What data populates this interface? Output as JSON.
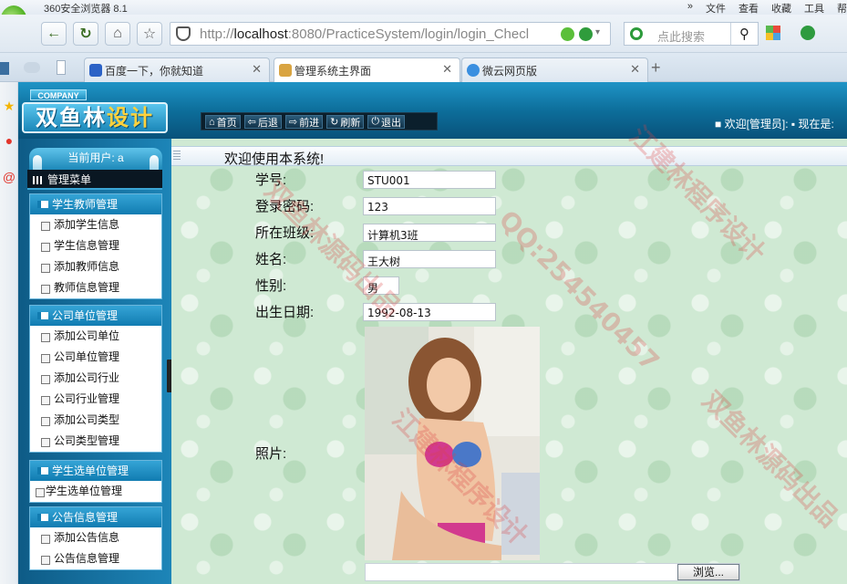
{
  "browser": {
    "title": "360安全浏览器 8.1",
    "menus": [
      "»",
      "文件",
      "查看",
      "收藏",
      "工具",
      "帮"
    ],
    "url_prefix": "http://",
    "url_host": "localhost",
    "url_rest": ":8080/PracticeSystem/login/login_Checl",
    "search_placeholder": "点此搜索",
    "tabs": [
      {
        "label": "百度一下，你就知道",
        "active": false
      },
      {
        "label": "管理系统主界面",
        "active": true
      },
      {
        "label": "微云网页版",
        "active": false
      }
    ],
    "close_glyph": "✕",
    "new_tab_glyph": "+"
  },
  "header": {
    "company": "COMPANY",
    "logo_text_a": "双鱼林",
    "logo_text_b": "设计",
    "toolbar": [
      {
        "icon": "home-icon",
        "glyph": "⌂",
        "label": "首页"
      },
      {
        "icon": "back-icon",
        "glyph": "⇦",
        "label": "后退"
      },
      {
        "icon": "forward-icon",
        "glyph": "⇨",
        "label": "前进"
      },
      {
        "icon": "refresh-icon",
        "glyph": "↻",
        "label": "刷新"
      },
      {
        "icon": "power-icon",
        "glyph": "⏻",
        "label": "退出"
      }
    ],
    "welcome": "■ 欢迎[管理员]: ▪ 现在是:"
  },
  "sidebar": {
    "current_user": "当前用户: a",
    "menu_title": "管理菜单",
    "groups": [
      {
        "title": "学生教师管理",
        "items": [
          "添加学生信息",
          "学生信息管理",
          "添加教师信息",
          "教师信息管理"
        ]
      },
      {
        "title": "公司单位管理",
        "items": [
          "添加公司单位",
          "公司单位管理",
          "添加公司行业",
          "公司行业管理",
          "添加公司类型",
          "公司类型管理"
        ]
      },
      {
        "title": "学生选单位管理",
        "items": [
          "学生选单位管理"
        ]
      },
      {
        "title": "公告信息管理",
        "items": [
          "添加公告信息",
          "公告信息管理"
        ]
      }
    ]
  },
  "main": {
    "welcome": "欢迎使用本系统!",
    "fields": [
      {
        "label": "学号:",
        "value": "STU001"
      },
      {
        "label": "登录密码:",
        "value": "123"
      },
      {
        "label": "所在班级:",
        "value": "计算机3班"
      },
      {
        "label": "姓名:",
        "value": "王大树"
      },
      {
        "label": "性别:",
        "value": "男"
      },
      {
        "label": "出生日期:",
        "value": "1992-08-13"
      }
    ],
    "photo_label": "照片:",
    "browse_button": "浏览..."
  },
  "watermarks": [
    "QQ:254540457",
    "双鱼林源码出品",
    "江建林程序设计"
  ]
}
